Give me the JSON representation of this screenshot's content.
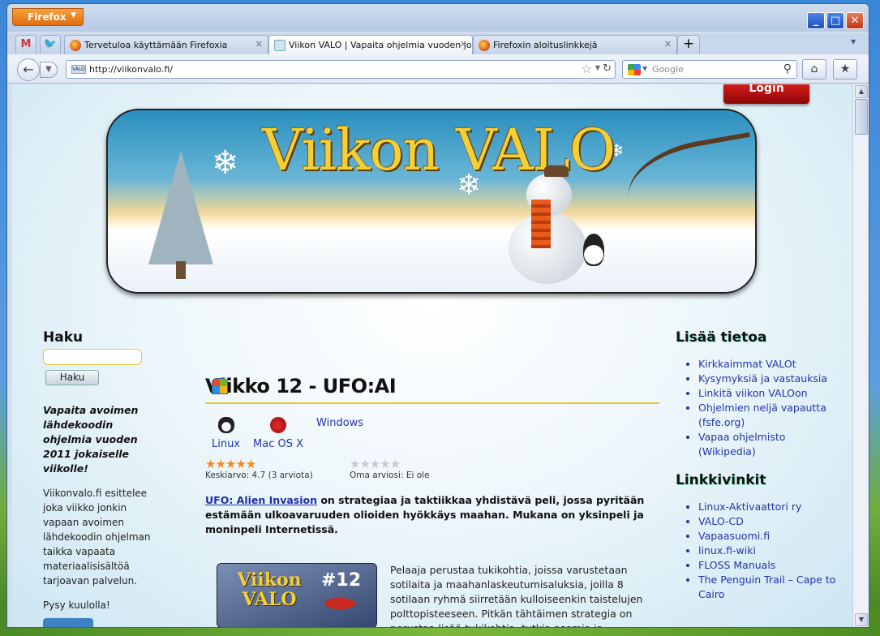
{
  "browser": {
    "app_button": "Firefox",
    "tabs": [
      {
        "label": "",
        "icon": "gmail-icon"
      },
      {
        "label": "",
        "icon": "twitter-icon"
      },
      {
        "label": "Tervetuloa käyttämään Firefoxia"
      },
      {
        "label": "Viikon VALO | Vapaita ohjelmia vuoden jo..."
      },
      {
        "label": "Firefoxin aloituslinkkejä"
      }
    ],
    "url": "http://viikonvalo.fi/",
    "url_badge": "VALO",
    "search_placeholder": "Google"
  },
  "site": {
    "login": "Login",
    "banner_title": "Viikon VALO",
    "left": {
      "search_heading": "Haku",
      "search_button": "Haku",
      "tagline": "Vapaita avoimen lähdekoodin ohjelmia vuoden 2011 jokaiselle viikolle!",
      "description": "Viikonvalo.fi esittelee joka viikko jonkin vapaan avoimen lähdekoodin ohjelman taikka vapaata materiaalisisältöä tarjoavan palvelun.",
      "stay_tuned": "Pysy kuulolla!"
    },
    "article": {
      "title": "Viikko 12 - UFO:AI",
      "os": [
        "Linux",
        "Mac OS X",
        "Windows"
      ],
      "rating_stars": "★★★★★",
      "rating_avg": 4.7,
      "rating_avg_text": "Keskiarvo: 4.7 (3 arviota)",
      "own_rating_stars": "★★★★★",
      "own_rating_text": "Oma arviosi: Ei ole",
      "intro_link": "UFO: Alien Invasion",
      "intro_rest": " on strategiaa ja taktiikkaa yhdistävä peli, jossa pyritään estämään ulkoavaruuden olioiden hyökkäys maahan. Mukana on yksinpeli ja moninpeli Internetissä.",
      "image_title": "Viikon VALO",
      "image_number": "#12",
      "body": "Pelaaja perustaa tukikohtia, joissa varustetaan sotilaita ja maahanlaskeutumisaluksia, joilla 8 sotilaan ryhmä siirretään kulloiseenkin taistelujen polttopisteeseen. Pitkän tähtäimen strategia on perustaa lisää tukikohtia, tutkia asemia ja"
    },
    "right": {
      "more_heading": "Lisää tietoa",
      "more_links": [
        "Kirkkaimmat VALOt",
        "Kysymyksiä ja vastauksia",
        "Linkitä viikon VALOon",
        "Ohjelmien neljä vapautta (fsfe.org)",
        "Vapaa ohjelmisto (Wikipedia)"
      ],
      "tips_heading": "Linkkivinkit",
      "tips_links": [
        "Linux-Aktivaattori ry",
        "VALO-CD",
        "Vapaasuomi.fi",
        "linux.fi-wiki",
        "FLOSS Manuals",
        "The Penguin Trail – Cape to Cairo"
      ]
    }
  }
}
